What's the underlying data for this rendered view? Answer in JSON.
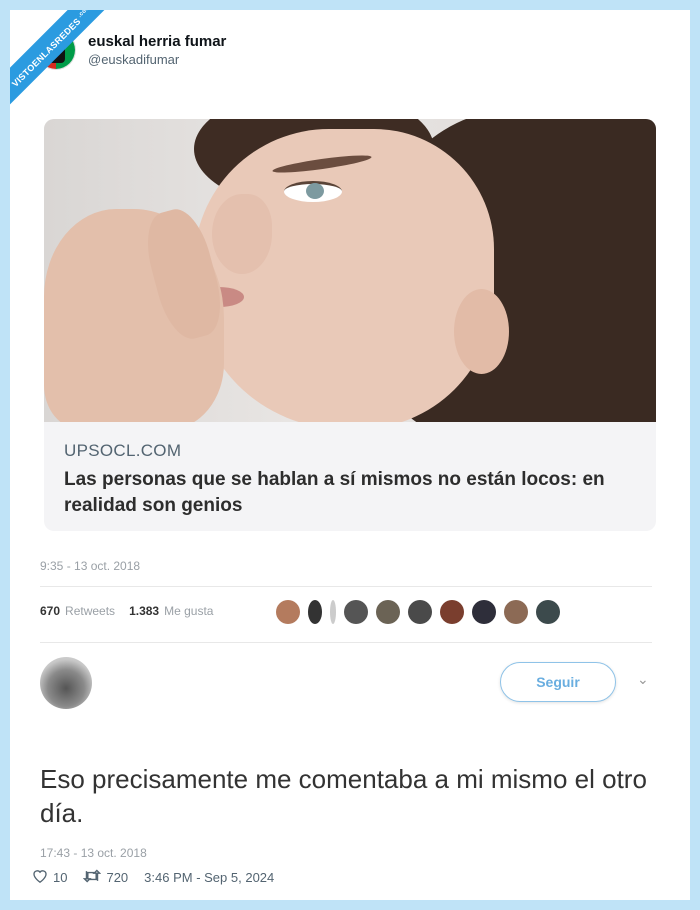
{
  "watermark": {
    "text": "VISTOENLASREDES",
    "suffix": ".com"
  },
  "post": {
    "display_name": "euskal herria fumar",
    "handle": "@euskadifumar"
  },
  "embedded_tweet": {
    "link_card": {
      "domain": "UPSOCL.COM",
      "title": "Las personas que se hablan a sí mismos no están locos: en realidad son genios"
    },
    "timestamp": "9:35 - 13 oct. 2018",
    "retweets_count": "670",
    "retweets_label": "Retweets",
    "likes_count": "1.383",
    "likes_label": "Me gusta"
  },
  "reply_tweet": {
    "follow_label": "Seguir",
    "text": "Eso precisamente me comentaba a mi mismo el otro día.",
    "timestamp": "17:43 - 13 oct. 2018"
  },
  "footer": {
    "likes": "10",
    "retweets": "720",
    "timestamp": "3:46 PM - Sep 5, 2024"
  },
  "colors": {
    "frame": "#bfe3f7",
    "ribbon": "#2b9be0",
    "follow_border": "#8fc3e8"
  }
}
